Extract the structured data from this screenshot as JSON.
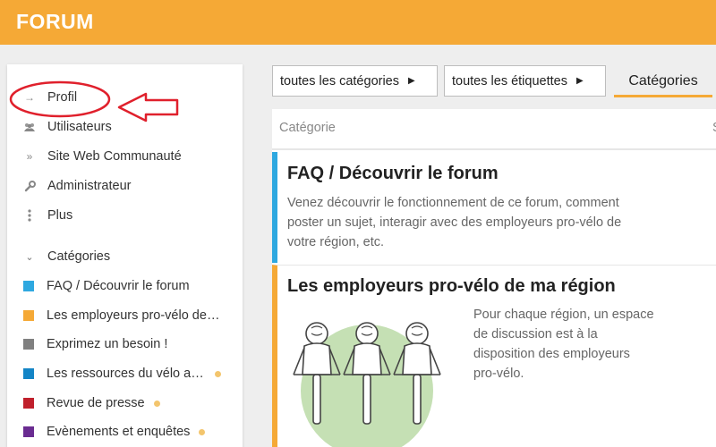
{
  "header": {
    "brand": "FORUM",
    "accent_color": "#f5a936"
  },
  "sidebar": {
    "nav": [
      {
        "label": "Profil",
        "icon": "arrow-right-icon"
      },
      {
        "label": "Utilisateurs",
        "icon": "users-icon"
      },
      {
        "label": "Site Web Communauté",
        "icon": "double-chevron-right-icon"
      },
      {
        "label": "Administrateur",
        "icon": "wrench-icon"
      },
      {
        "label": "Plus",
        "icon": "vertical-ellipsis-icon"
      }
    ],
    "categories_title": "Catégories",
    "categories": [
      {
        "label": "FAQ / Découvrir le forum",
        "color": "#2ea8e0",
        "unread": false
      },
      {
        "label": "Les employeurs pro-vélo de ma région",
        "color": "#f5a936",
        "unread": false
      },
      {
        "label": "Exprimez un besoin !",
        "color": "#808080",
        "unread": false
      },
      {
        "label": "Les ressources du vélo au travail",
        "color": "#1485c6",
        "unread": true
      },
      {
        "label": "Revue de presse",
        "color": "#c0202c",
        "unread": true
      },
      {
        "label": "Evènements et enquêtes",
        "color": "#6a2c91",
        "unread": true
      }
    ]
  },
  "annotation": {
    "color": "#e0202c"
  },
  "filters": {
    "categories": "toutes les catégories",
    "tags": "toutes les étiquettes",
    "tab_active": "Catégories"
  },
  "table": {
    "col_category": "Catégorie",
    "col_second": "S",
    "rows": [
      {
        "title": "FAQ / Découvrir le forum",
        "description_lines": [
          "Venez découvrir le fonctionnement de ce forum, comment",
          "poster un sujet, interagir avec des employeurs pro-vélo de",
          "votre région, etc."
        ]
      },
      {
        "title": "Les employeurs pro-vélo de ma région",
        "description_lines": [
          "Pour chaque région, un espace",
          "de discussion est à la",
          "disposition des employeurs",
          "pro-vélo."
        ]
      }
    ]
  }
}
